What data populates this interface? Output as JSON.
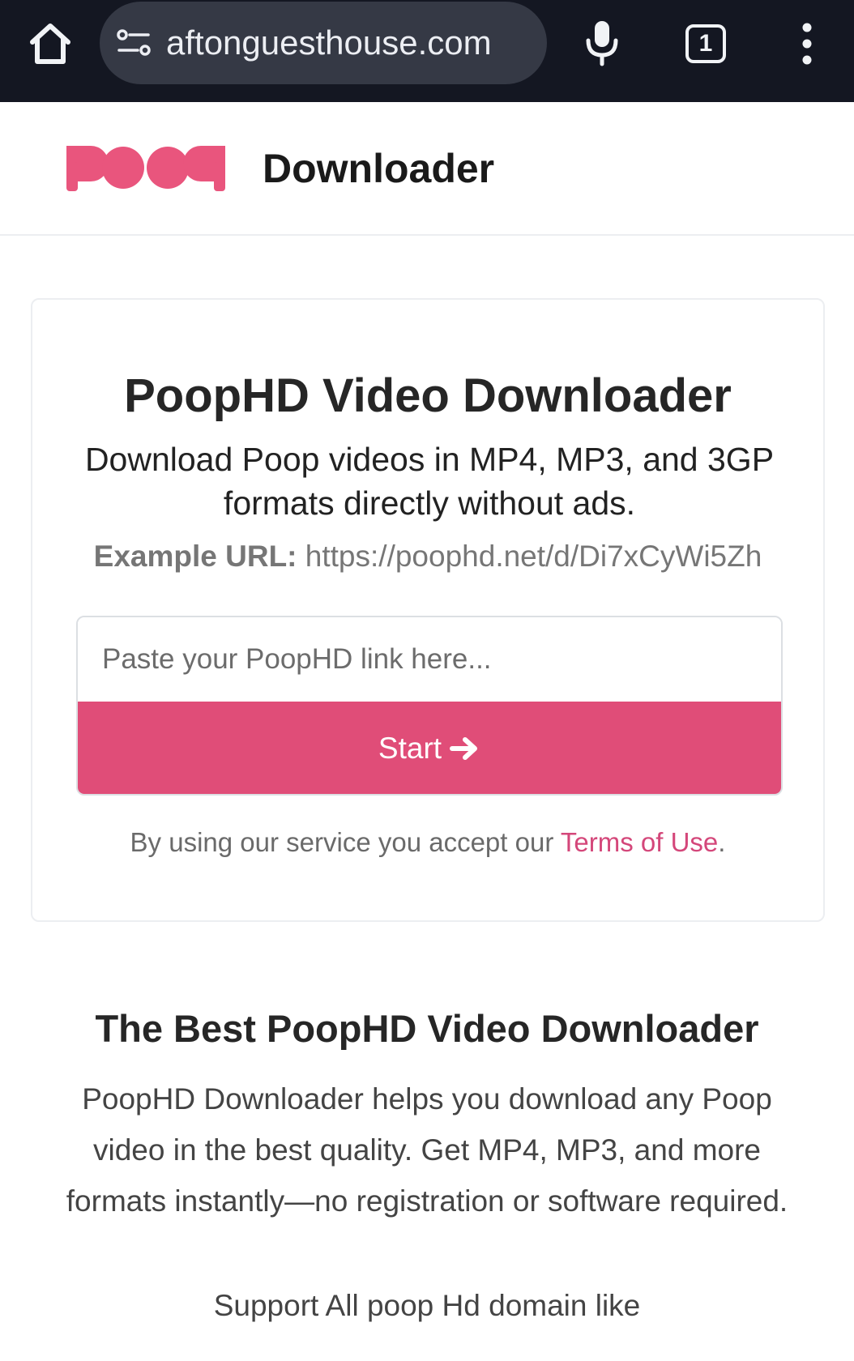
{
  "browser": {
    "url": "aftonguesthouse.com",
    "tab_count": "1",
    "icons": [
      "home-icon",
      "site-settings-icon",
      "microphone-icon",
      "tab-switcher-icon",
      "more-vert-icon"
    ]
  },
  "header": {
    "logo_text": "poop",
    "title": "Downloader"
  },
  "card": {
    "title": "PoopHD Video Downloader",
    "subtitle": "Download Poop videos in MP4, MP3, and 3GP formats directly without ads.",
    "example_label": "Example URL:",
    "example_url": "https://poophd.net/d/Di7xCyWi5Zh",
    "input_placeholder": "Paste your PoopHD link here...",
    "input_value": "",
    "start_label": "Start",
    "terms_prefix": "By using our service you accept our",
    "terms_link": "Terms of Use",
    "terms_suffix": "."
  },
  "section": {
    "title": "The Best PoopHD Video Downloader",
    "body": "PoopHD Downloader helps you download any Poop video in the best quality. Get MP4, MP3, and more formats instantly—no registration or software required.",
    "extra": "Support All poop Hd domain like"
  },
  "colors": {
    "browser_bar": "#141722",
    "url_pill": "#353945",
    "accent": "#e04d78",
    "link": "#d4477a",
    "logo": "#e9557d"
  }
}
